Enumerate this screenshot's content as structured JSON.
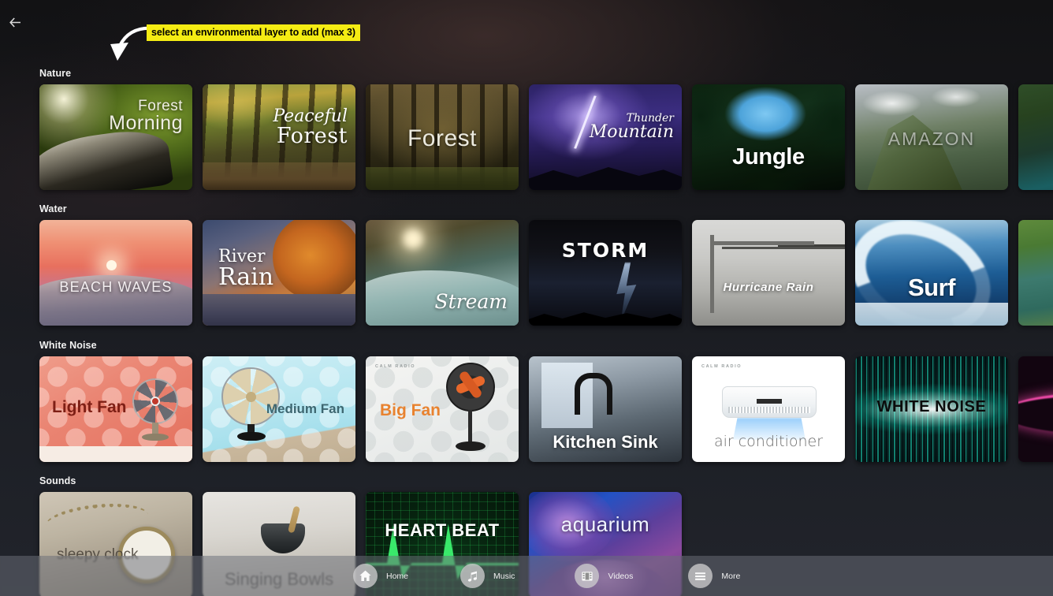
{
  "header": {
    "back_icon": "back-arrow-icon"
  },
  "annotation": {
    "text": "select an environmental layer to add (max 3)",
    "arrow_icon": "curved-arrow-icon",
    "highlight_color": "#f5ec13"
  },
  "rows": [
    {
      "title": "Nature",
      "cards": [
        {
          "label": "Forest Morning",
          "label_line1": "Forest",
          "label_line2": "Morning"
        },
        {
          "label": "Peaceful Forest",
          "label_line1": "Peaceful",
          "label_line2": "Forest"
        },
        {
          "label": "Forest"
        },
        {
          "label": "Thunder Mountain",
          "label_line1": "Thunder",
          "label_line2": "Mountain"
        },
        {
          "label": "Jungle"
        },
        {
          "label": "AMAZON"
        },
        {
          "label": ""
        }
      ]
    },
    {
      "title": "Water",
      "cards": [
        {
          "label": "BEACH WAVES"
        },
        {
          "label": "River Rain",
          "label_line1": "River",
          "label_line2": "Rain"
        },
        {
          "label": "Stream"
        },
        {
          "label": "STORM"
        },
        {
          "label": "Hurricane Rain"
        },
        {
          "label": "Surf"
        },
        {
          "label": ""
        }
      ]
    },
    {
      "title": "White Noise",
      "cards": [
        {
          "label": "Light Fan"
        },
        {
          "label": "Medium Fan"
        },
        {
          "label": "Big Fan",
          "brand": "CALM RADIO"
        },
        {
          "label": "Kitchen Sink"
        },
        {
          "label": "air conditioner",
          "brand": "CALM RADIO"
        },
        {
          "label": "WHITE NOISE"
        },
        {
          "label": ""
        }
      ]
    },
    {
      "title": "Sounds",
      "cards": [
        {
          "label": "sleepy clock"
        },
        {
          "label": "Singing Bowls"
        },
        {
          "label": "HEART BEAT"
        },
        {
          "label": "aquarium"
        }
      ]
    }
  ],
  "bottom_nav": {
    "items": [
      {
        "label": "Home",
        "icon": "home-icon"
      },
      {
        "label": "Music",
        "icon": "music-note-icon"
      },
      {
        "label": "Videos",
        "icon": "film-strip-icon"
      },
      {
        "label": "More",
        "icon": "hamburger-menu-icon"
      }
    ]
  }
}
